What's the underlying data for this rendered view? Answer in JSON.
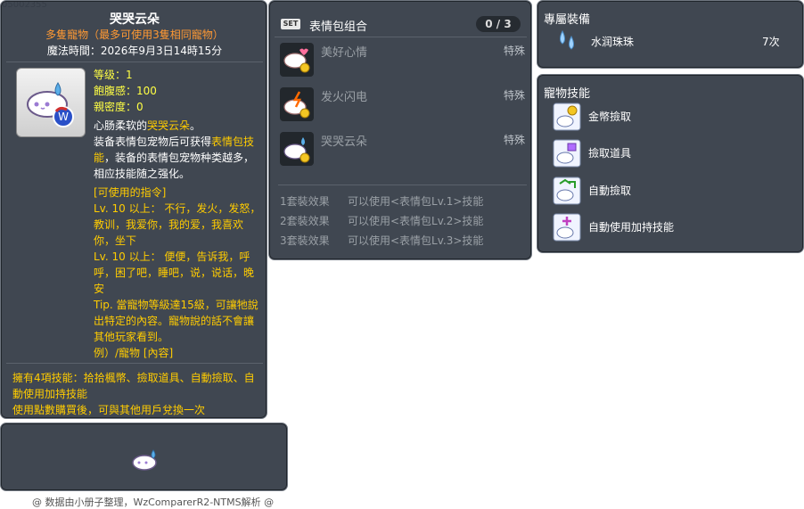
{
  "item_id": "05002355",
  "main": {
    "title": "哭哭云朵",
    "subtitle": "多隻寵物（最多可使用3隻相同寵物）",
    "time_label": "魔法時間：2026年9月3日14時15分",
    "stats": {
      "level": "等级：1",
      "fullness": "飽腹感：100",
      "closeness": "親密度：0"
    },
    "desc_line1_a": "心肠柔软的",
    "desc_line1_b": "哭哭云朵",
    "desc_line1_c": "。",
    "desc_line2_a": "装备表情包宠物后可获得",
    "desc_line2_b": "表情包技能",
    "desc_line2_c": "，装备的表情包宠物种类越多，相应技能随之强化。",
    "commands": [
      "[可使用的指令]",
      "Lv. 10 以上： 不行，发火，发怒，教训，我爱你，我的爱，我喜欢你，坐下",
      "Lv. 10 以上： 便便，告诉我，呼呼，困了吧，睡吧，说，说话，晚安",
      "Tip. 當寵物等級達15級，可讓牠說出特定的內容。寵物說的話不會讓其他玩家看到。",
      "例）/寵物 [內容]"
    ],
    "bottom_lines": [
      "擁有4項技能：拾拾楓幣、撿取道具、自動撿取、自動使用加持技能",
      "使用點數購買後，可與其他用戶兌換一次"
    ]
  },
  "footer": "@ 数据由小册子整理，WzComparerR2-NTMS解析 @",
  "set": {
    "badge": "SET",
    "title": "表情包组合",
    "count": "0 / 3",
    "items": [
      {
        "name": "美好心情",
        "type": "特殊"
      },
      {
        "name": "发火闪电",
        "type": "特殊"
      },
      {
        "name": "哭哭云朵",
        "type": "特殊"
      }
    ],
    "effects": [
      {
        "label": "1套裝效果",
        "value": "可以使用<表情包Lv.1>技能"
      },
      {
        "label": "2套裝效果",
        "value": "可以使用<表情包Lv.2>技能"
      },
      {
        "label": "3套裝效果",
        "value": "可以使用<表情包Lv.3>技能"
      }
    ]
  },
  "equip": {
    "title": "專屬裝備",
    "name": "水润珠珠",
    "count": "7次"
  },
  "skills": {
    "title": "寵物技能",
    "items": [
      {
        "name": "金幣撿取",
        "icon": "meso-pickup-icon"
      },
      {
        "name": "撿取道具",
        "icon": "item-pickup-icon"
      },
      {
        "name": "自動撿取",
        "icon": "auto-pickup-icon"
      },
      {
        "name": "自動使用加持技能",
        "icon": "auto-buff-icon"
      }
    ]
  },
  "colors": {
    "panel_bg": "#38404a",
    "gold": "#ffcc00",
    "orange": "#ff9933",
    "yellow": "#ffff44"
  }
}
